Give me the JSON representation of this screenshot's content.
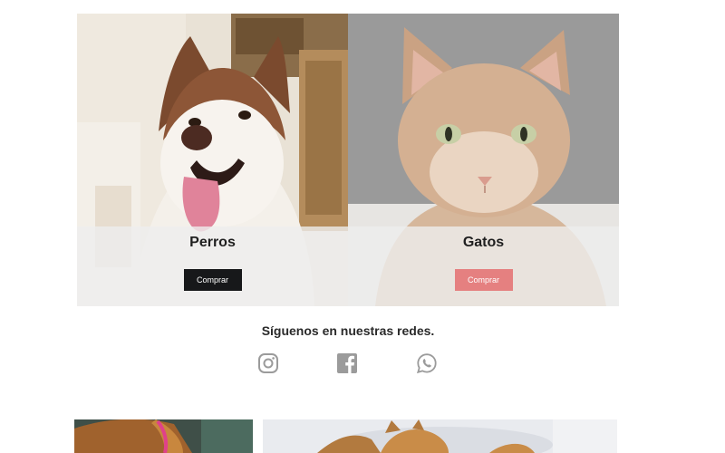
{
  "categories": [
    {
      "title": "Perros",
      "button_label": "Comprar",
      "image": "husky-dog-photo"
    },
    {
      "title": "Gatos",
      "button_label": "Comprar",
      "image": "ginger-cat-photo"
    }
  ],
  "social": {
    "title": "Síguenos en nuestras redes.",
    "icons": [
      "instagram-icon",
      "facebook-icon",
      "whatsapp-icon"
    ]
  },
  "colors": {
    "button_dark": "#17181a",
    "button_pink": "#e58080",
    "icon_gray": "#9b9b9b"
  }
}
